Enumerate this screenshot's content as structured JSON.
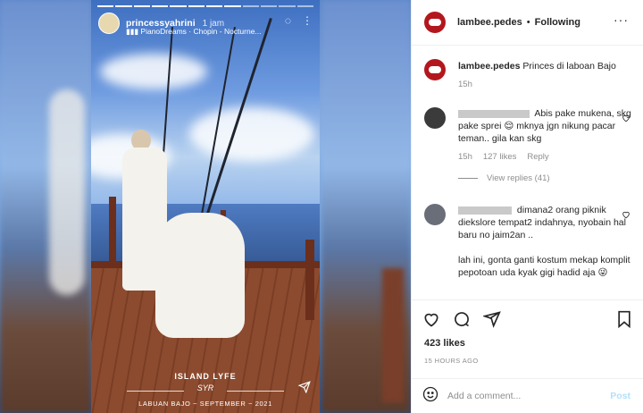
{
  "story": {
    "username": "princessyahrini",
    "time": "1 jam",
    "music": "PianoDreams · Chopin - Nocturne...",
    "caption_title": "ISLAND LYFE",
    "caption_sig": "SYR",
    "caption_location": "LABUAN BAJO ~ SEPTEMBER ~ 2021"
  },
  "post": {
    "username": "lambee.pedes",
    "follow_state": "Following",
    "caption_user": "lambee.pedes",
    "caption_text": "Princes di laboan Bajo",
    "caption_time": "15h",
    "comments": [
      {
        "text": "Abis pake mukena, skg pake sprei 😌 mknya jgn nikung pacar teman.. gila kan skg",
        "time": "15h",
        "likes": "127 likes",
        "reply": "Reply",
        "view_replies": "View replies (41)"
      },
      {
        "text_line1": "dimana2 orang piknik diekslore tempat2 indahnya, nyobain hal baru no jaim2an ..",
        "text_line2": "lah ini, gonta ganti kostum mekap komplit pepotoan uda kyak gigi hadid aja 😜"
      }
    ],
    "likes": "423 likes",
    "ago": "15 HOURS AGO",
    "add_comment_placeholder": "Add a comment...",
    "post_label": "Post"
  },
  "colors": {
    "brand_avatar": "#b3171d",
    "post_disabled": "#b2dffc"
  }
}
